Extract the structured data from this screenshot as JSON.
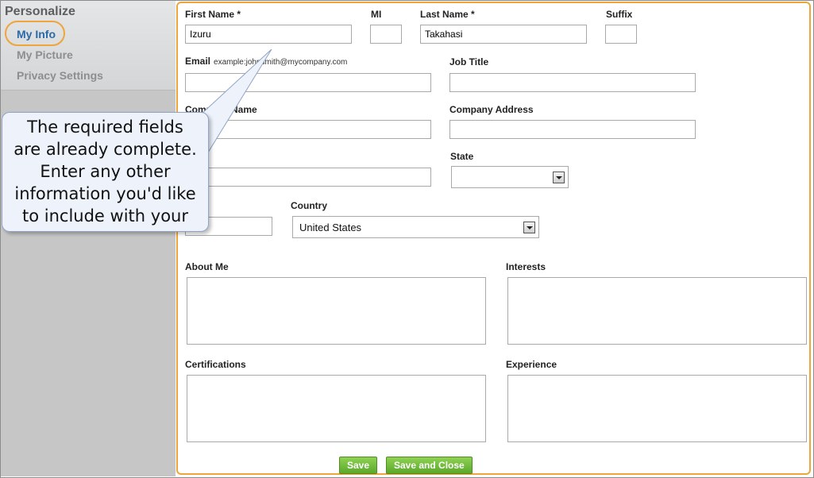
{
  "sidebar": {
    "title": "Personalize",
    "items": [
      {
        "label": "My Info",
        "active": true
      },
      {
        "label": "My Picture",
        "active": false
      },
      {
        "label": "Privacy Settings",
        "active": false
      }
    ]
  },
  "form": {
    "first_name": {
      "label": "First Name *",
      "value": "Izuru"
    },
    "mi": {
      "label": "MI",
      "value": ""
    },
    "last_name": {
      "label": "Last Name *",
      "value": "Takahasi"
    },
    "suffix": {
      "label": "Suffix",
      "value": ""
    },
    "email": {
      "label": "Email",
      "hint": "example:johnsmith@mycompany.com",
      "value": ""
    },
    "job_title": {
      "label": "Job Title",
      "value": ""
    },
    "company_name": {
      "label": "Company Name",
      "value": ""
    },
    "company_address": {
      "label": "Company Address",
      "value": ""
    },
    "city": {
      "value": ""
    },
    "state": {
      "label": "State",
      "value": ""
    },
    "zip": {
      "value": ""
    },
    "country": {
      "label": "Country",
      "value": "United States"
    },
    "about_me": {
      "label": "About Me"
    },
    "interests": {
      "label": "Interests"
    },
    "certifications": {
      "label": "Certifications"
    },
    "experience": {
      "label": "Experience"
    }
  },
  "buttons": {
    "save": "Save",
    "save_close": "Save and Close"
  },
  "callout": {
    "lines": [
      "The required fields",
      "are already complete.",
      "Enter any other",
      "information you'd like",
      "to include with your"
    ]
  },
  "colors": {
    "accent_orange": "#f0a43c",
    "active_link": "#2b6aa9",
    "button_green": "#6ab936",
    "callout_bg": "#eef3fb"
  }
}
